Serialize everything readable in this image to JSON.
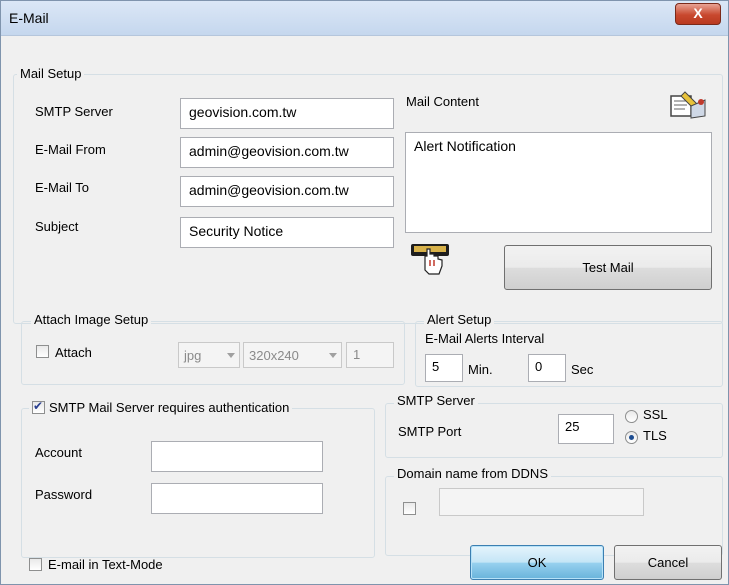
{
  "window": {
    "title": "E-Mail",
    "close_glyph": "X"
  },
  "mail_setup": {
    "legend": "Mail Setup",
    "smtp_server_label": "SMTP Server",
    "smtp_server_value": "geovision.com.tw",
    "from_label": "E-Mail From",
    "from_value": "admin@geovision.com.tw",
    "to_label": "E-Mail To",
    "to_value": "admin@geovision.com.tw",
    "subject_label": "Subject",
    "subject_value": "Security Notice",
    "content_label": "Mail Content",
    "content_value": "Alert Notification",
    "test_mail_label": "Test Mail"
  },
  "attach_setup": {
    "legend": "Attach Image Setup",
    "attach_label": "Attach",
    "attach_checked": false,
    "format_value": "jpg",
    "size_value": "320x240",
    "count_value": "1"
  },
  "alert_setup": {
    "legend": "Alert Setup",
    "interval_label": "E-Mail Alerts Interval",
    "min_value": "5",
    "min_label": "Min.",
    "sec_value": "0",
    "sec_label": "Sec"
  },
  "auth": {
    "checkbox_label": "SMTP Mail Server requires authentication",
    "checked": true,
    "account_label": "Account",
    "account_value": "",
    "password_label": "Password",
    "password_value": ""
  },
  "smtp_server_group": {
    "legend": "SMTP Server",
    "port_label": "SMTP Port",
    "port_value": "25",
    "ssl_label": "SSL",
    "tls_label": "TLS",
    "selected": "TLS"
  },
  "ddns": {
    "legend": "Domain name from DDNS",
    "checked": false,
    "value": ""
  },
  "footer": {
    "text_mode_label": "E-mail in Text-Mode",
    "text_mode_checked": false,
    "ok_label": "OK",
    "cancel_label": "Cancel"
  },
  "icons": [
    "mail-content-editor-icon",
    "hand-pointer-icon",
    "close-icon"
  ]
}
